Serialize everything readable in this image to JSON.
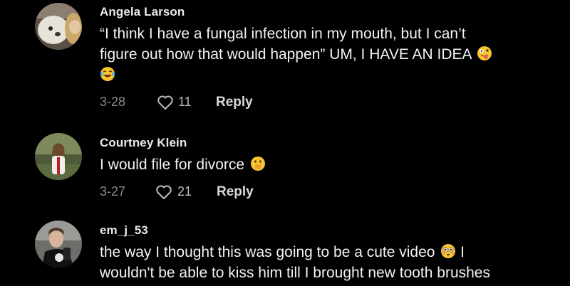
{
  "comments": [
    {
      "username": "Angela Larson",
      "text_line1": "“I think I have a fungal infection in my mouth, but I can’t",
      "text_line2": "figure out how that would happen” UM, I HAVE AN IDEA",
      "emojis": [
        "zany-face",
        "tears-of-joy"
      ],
      "date": "3-28",
      "likes": "11",
      "reply_label": "Reply"
    },
    {
      "username": "Courtney Klein",
      "text_line1": "I would file for divorce",
      "emojis": [
        "face-with-hand-over-mouth"
      ],
      "date": "3-27",
      "likes": "21",
      "reply_label": "Reply"
    },
    {
      "username": "em_j_53",
      "text_line1": "the way I thought this was going to be a cute video",
      "text_line1_end": "I",
      "text_line2": "wouldn't be able to kiss him till I brought new tooth brushes",
      "emojis": [
        "flushed-face"
      ]
    }
  ],
  "colors": {
    "background": "#000000",
    "username": "#e9e9e9",
    "text": "#f2f2f2",
    "meta": "#8a8a8a",
    "emoji_yellow": "#f7c531"
  }
}
